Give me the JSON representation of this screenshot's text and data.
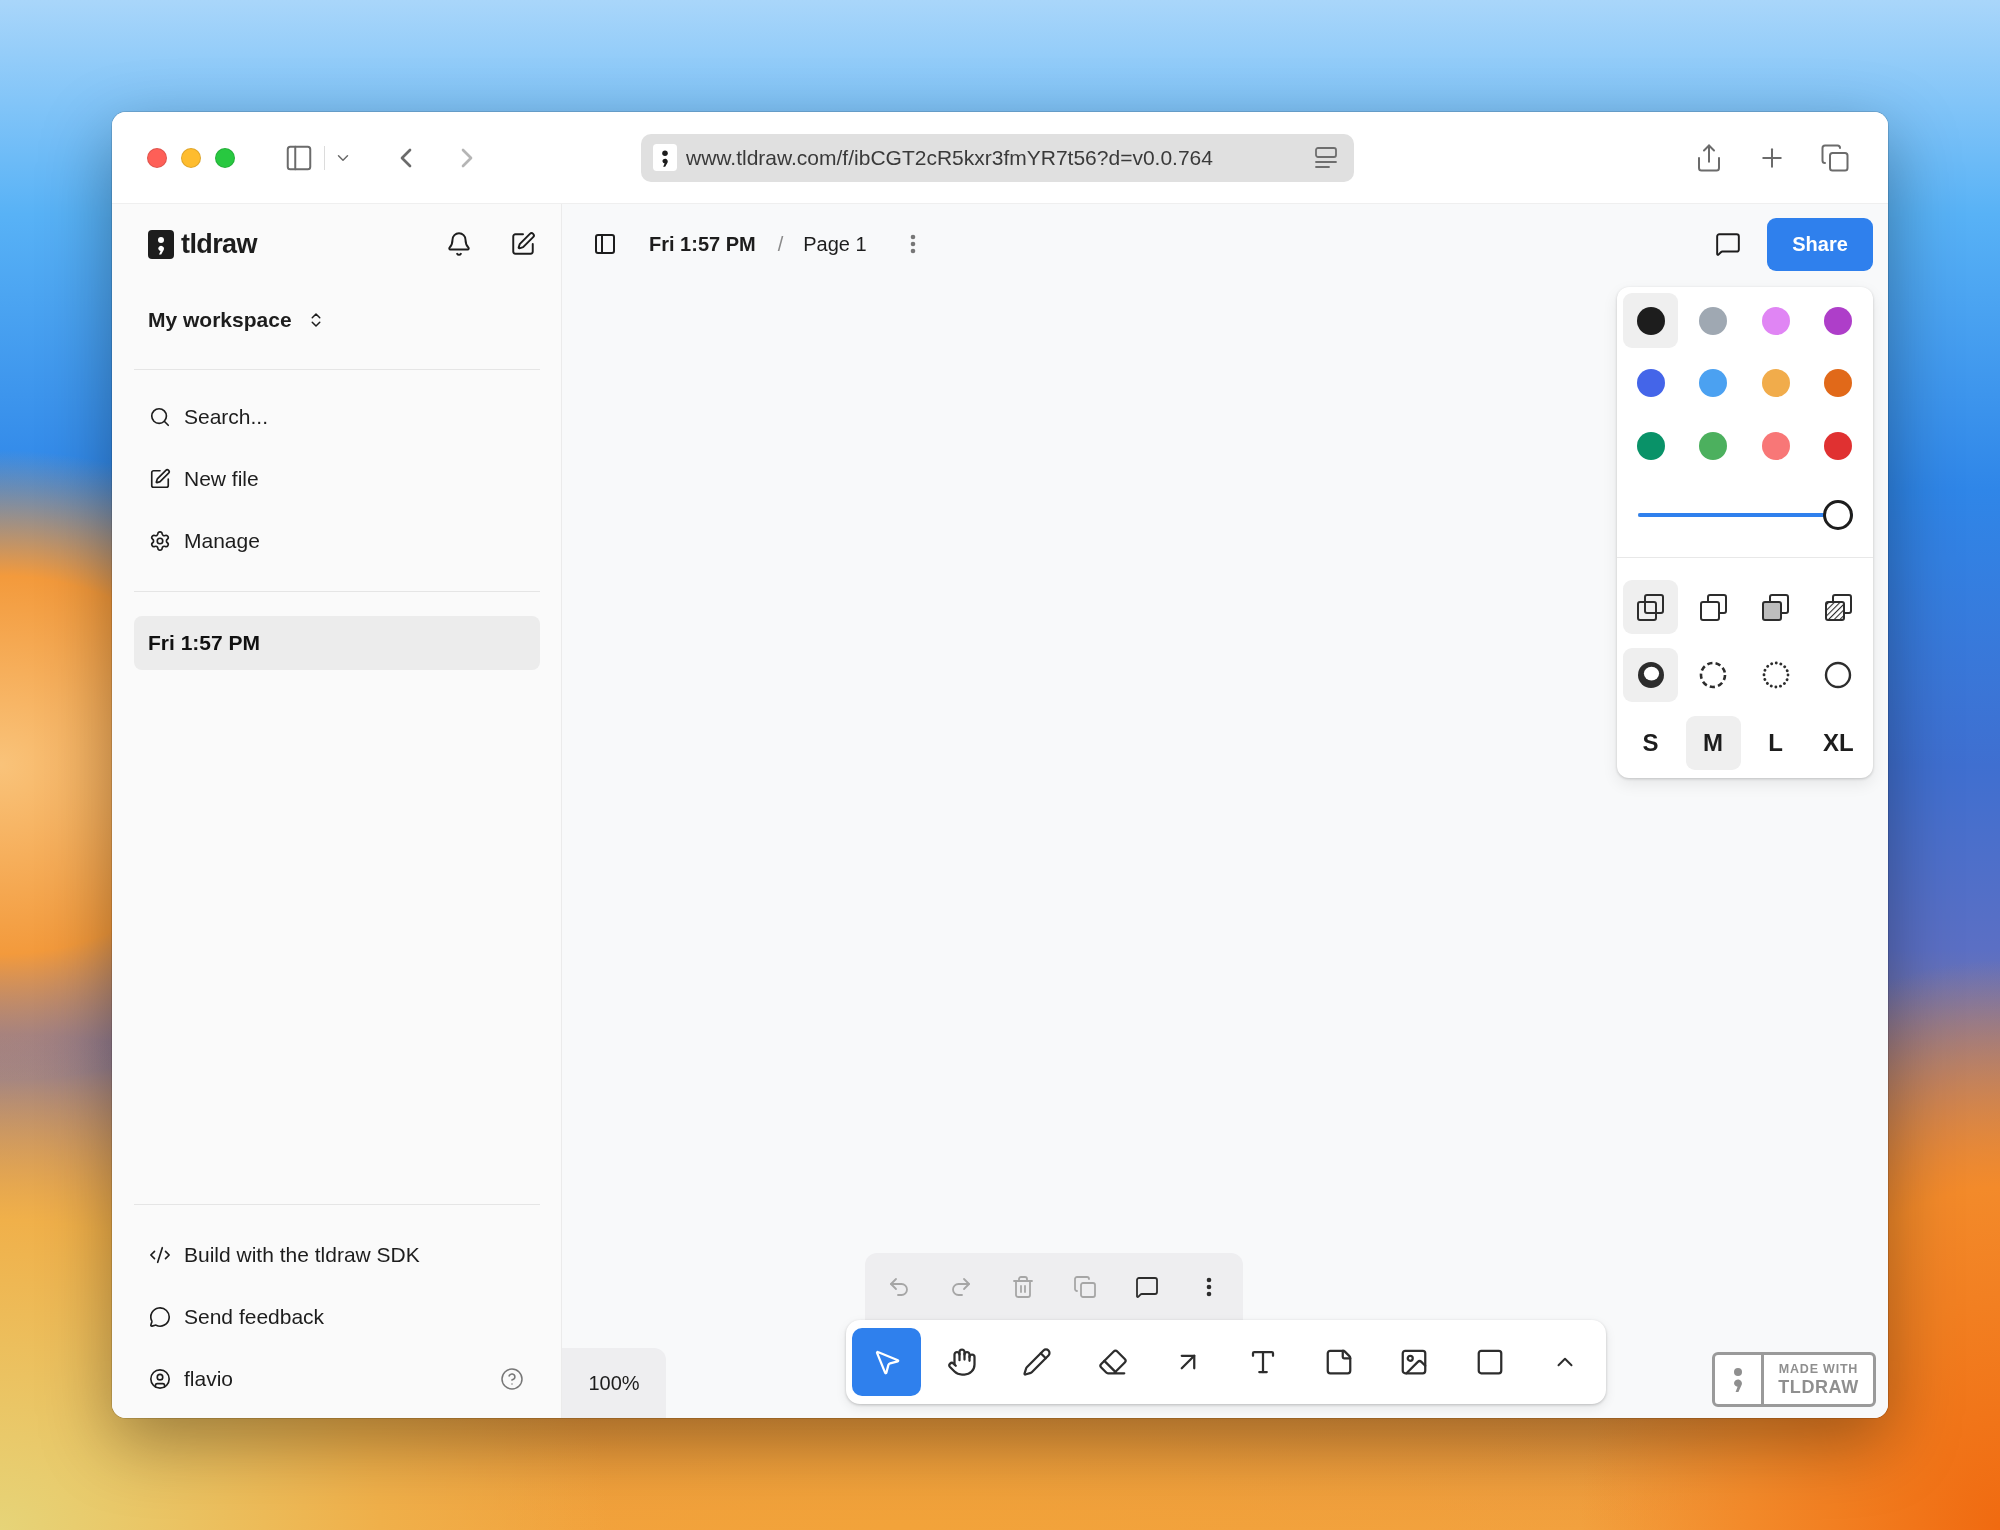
{
  "browser": {
    "url": "www.tldraw.com/f/ibCGT2cR5kxr3fmYR7t56?d=v0.0.764"
  },
  "sidebar": {
    "brand": "tldraw",
    "workspace": "My workspace",
    "menu": [
      {
        "kind": "search",
        "label": "Search..."
      },
      {
        "kind": "new",
        "label": "New file"
      },
      {
        "kind": "manage",
        "label": "Manage"
      }
    ],
    "files": [
      {
        "label": "Fri 1:57 PM",
        "selected": true
      }
    ],
    "footer": [
      {
        "kind": "code",
        "label": "Build with the tldraw SDK"
      },
      {
        "kind": "feedback",
        "label": "Send feedback"
      },
      {
        "kind": "user",
        "label": "flavio"
      }
    ]
  },
  "header": {
    "file": "Fri 1:57 PM",
    "separator": "/",
    "page": "Page 1",
    "share": "Share"
  },
  "style_panel": {
    "colors": [
      {
        "color": "#1d1d1d",
        "selected": true
      },
      {
        "color": "#9fa8b2",
        "selected": false
      },
      {
        "color": "#e085f4",
        "selected": false
      },
      {
        "color": "#ae3ec9",
        "selected": false
      },
      {
        "color": "#4465e9",
        "selected": false
      },
      {
        "color": "#4ba1f1",
        "selected": false
      },
      {
        "color": "#f1ac4b",
        "selected": false
      },
      {
        "color": "#e16919",
        "selected": false
      },
      {
        "color": "#099268",
        "selected": false
      },
      {
        "color": "#4cb05e",
        "selected": false
      },
      {
        "color": "#f87777",
        "selected": false
      },
      {
        "color": "#e03131",
        "selected": false
      }
    ],
    "opacity": {
      "level": 1
    },
    "fills": [
      {
        "kind": "none",
        "selected": true
      },
      {
        "kind": "semi",
        "selected": false
      },
      {
        "kind": "solid",
        "selected": false
      },
      {
        "kind": "pattern",
        "selected": false
      }
    ],
    "dashes": [
      {
        "kind": "draw",
        "selected": true
      },
      {
        "kind": "dashed",
        "selected": false
      },
      {
        "kind": "dotted",
        "selected": false
      },
      {
        "kind": "solid",
        "selected": false
      }
    ],
    "sizes": [
      {
        "label": "S",
        "selected": false
      },
      {
        "label": "M",
        "selected": true
      },
      {
        "label": "L",
        "selected": false
      },
      {
        "label": "XL",
        "selected": false
      }
    ]
  },
  "quick_actions": [
    {
      "kind": "undo",
      "disabled": true
    },
    {
      "kind": "redo",
      "disabled": true
    },
    {
      "kind": "delete",
      "disabled": true
    },
    {
      "kind": "duplicate",
      "disabled": true
    },
    {
      "kind": "comment",
      "disabled": false
    },
    {
      "kind": "more",
      "disabled": false
    }
  ],
  "toolbar": [
    {
      "kind": "select",
      "selected": true
    },
    {
      "kind": "hand",
      "selected": false
    },
    {
      "kind": "draw",
      "selected": false
    },
    {
      "kind": "eraser",
      "selected": false
    },
    {
      "kind": "arrow",
      "selected": false
    },
    {
      "kind": "text",
      "selected": false
    },
    {
      "kind": "note",
      "selected": false
    },
    {
      "kind": "image",
      "selected": false
    },
    {
      "kind": "rectangle",
      "selected": false
    },
    {
      "kind": "more",
      "selected": false
    }
  ],
  "zoom": "100%",
  "badge": {
    "line_1": "MADE WITH",
    "line_2": "TLDRAW"
  }
}
